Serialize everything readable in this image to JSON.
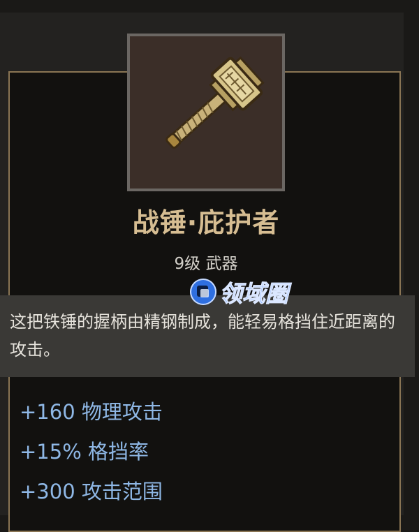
{
  "item": {
    "icon": "war-hammer-icon",
    "name": "战锤·庇护者",
    "meta": "9级 武器",
    "description": "这把铁锤的握柄由精钢制成，能轻易格挡住近距离的攻击。",
    "stats": [
      "+160 物理攻击",
      "+15% 格挡率",
      "+300 攻击范围"
    ]
  },
  "watermark": {
    "text": "领域圈"
  },
  "colors": {
    "name": "#d6bd92",
    "frame": "#8a7554",
    "stat": "#8fb8e6",
    "watermark": "#3b82ff"
  }
}
